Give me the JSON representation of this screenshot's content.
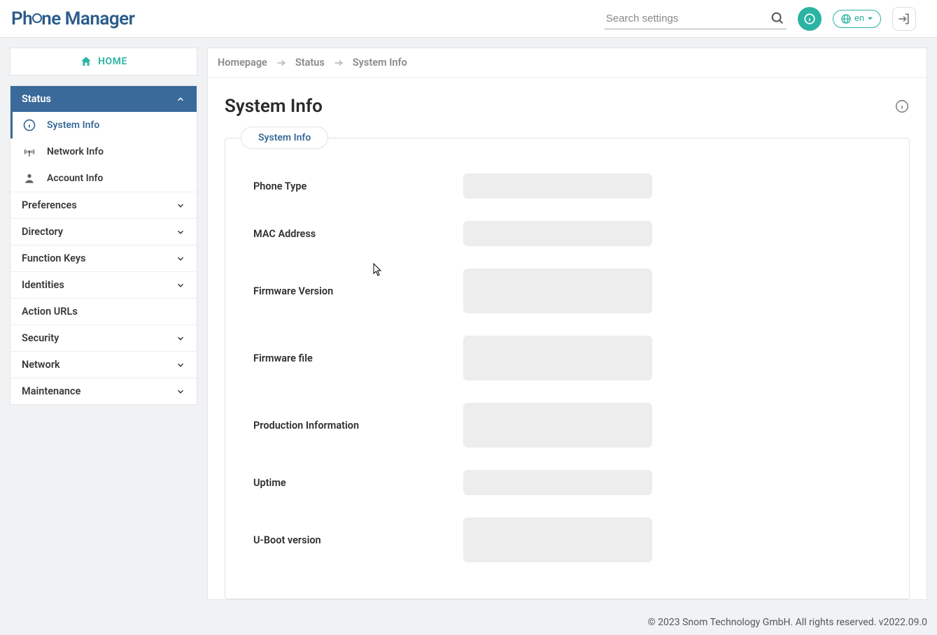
{
  "app_title": "Phone Manager",
  "header": {
    "search_placeholder": "Search settings",
    "lang_label": "en"
  },
  "sidebar": {
    "home_label": "HOME",
    "sections": [
      {
        "label": "Status",
        "expanded": true
      },
      {
        "label": "Preferences",
        "expanded": false
      },
      {
        "label": "Directory",
        "expanded": false
      },
      {
        "label": "Function Keys",
        "expanded": false
      },
      {
        "label": "Identities",
        "expanded": false
      },
      {
        "label": "Action URLs",
        "expanded": false,
        "no_chevron": true
      },
      {
        "label": "Security",
        "expanded": false
      },
      {
        "label": "Network",
        "expanded": false
      },
      {
        "label": "Maintenance",
        "expanded": false
      }
    ],
    "status_sub": [
      {
        "label": "System Info"
      },
      {
        "label": "Network Info"
      },
      {
        "label": "Account Info"
      }
    ]
  },
  "breadcrumb": {
    "home": "Homepage",
    "mid": "Status",
    "current": "System Info"
  },
  "page": {
    "title": "System Info",
    "tab_label": "System Info"
  },
  "fields": [
    {
      "label": "Phone Type",
      "tall": false
    },
    {
      "label": "MAC Address",
      "tall": false
    },
    {
      "label": "Firmware Version",
      "tall": true
    },
    {
      "label": "Firmware file",
      "tall": true
    },
    {
      "label": "Production Information",
      "tall": true
    },
    {
      "label": "Uptime",
      "tall": false
    },
    {
      "label": "U-Boot version",
      "tall": true
    }
  ],
  "footer": "© 2023 Snom Technology GmbH. All rights reserved. v2022.09.0"
}
